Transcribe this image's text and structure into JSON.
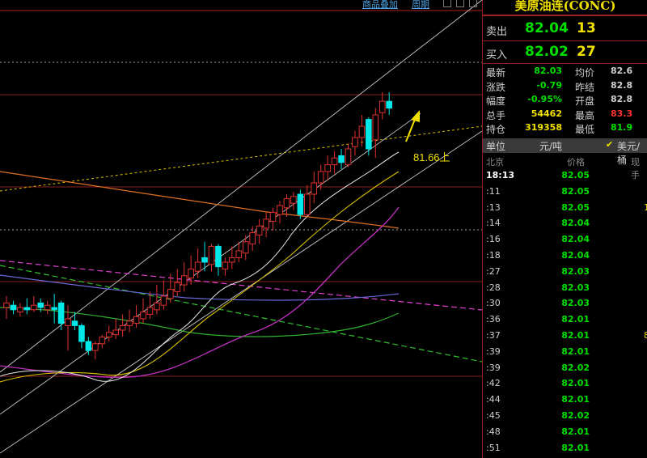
{
  "toolbar": {
    "link1": "商品叠加",
    "link2": "周期"
  },
  "chart_data": {
    "type": "candlestick",
    "annotation": "81.66上",
    "candles": [
      {
        "o": 0.5,
        "c": 0.52,
        "h": 0.55,
        "l": 0.45
      },
      {
        "o": 0.51,
        "c": 0.49,
        "h": 0.53,
        "l": 0.47
      },
      {
        "o": 0.48,
        "c": 0.5,
        "h": 0.52,
        "l": 0.46
      },
      {
        "o": 0.5,
        "c": 0.49,
        "h": 0.54,
        "l": 0.47
      },
      {
        "o": 0.49,
        "c": 0.51,
        "h": 0.55,
        "l": 0.48
      },
      {
        "o": 0.52,
        "c": 0.5,
        "h": 0.54,
        "l": 0.48
      },
      {
        "o": 0.49,
        "c": 0.51,
        "h": 0.53,
        "l": 0.47
      },
      {
        "o": 0.5,
        "c": 0.49,
        "h": 0.56,
        "l": 0.43
      },
      {
        "o": 0.52,
        "c": 0.43,
        "h": 0.53,
        "l": 0.4
      },
      {
        "o": 0.42,
        "c": 0.45,
        "h": 0.51,
        "l": 0.31
      },
      {
        "o": 0.44,
        "c": 0.42,
        "h": 0.48,
        "l": 0.4
      },
      {
        "o": 0.42,
        "c": 0.35,
        "h": 0.43,
        "l": 0.32
      },
      {
        "o": 0.35,
        "c": 0.31,
        "h": 0.37,
        "l": 0.29
      },
      {
        "o": 0.31,
        "c": 0.34,
        "h": 0.35,
        "l": 0.27
      },
      {
        "o": 0.34,
        "c": 0.37,
        "h": 0.38,
        "l": 0.32
      },
      {
        "o": 0.37,
        "c": 0.39,
        "h": 0.42,
        "l": 0.35
      },
      {
        "o": 0.38,
        "c": 0.4,
        "h": 0.45,
        "l": 0.36
      },
      {
        "o": 0.4,
        "c": 0.42,
        "h": 0.47,
        "l": 0.37
      },
      {
        "o": 0.42,
        "c": 0.44,
        "h": 0.49,
        "l": 0.39
      },
      {
        "o": 0.43,
        "c": 0.46,
        "h": 0.51,
        "l": 0.41
      },
      {
        "o": 0.45,
        "c": 0.48,
        "h": 0.54,
        "l": 0.43
      },
      {
        "o": 0.47,
        "c": 0.5,
        "h": 0.57,
        "l": 0.45
      },
      {
        "o": 0.49,
        "c": 0.52,
        "h": 0.6,
        "l": 0.47
      },
      {
        "o": 0.51,
        "c": 0.55,
        "h": 0.62,
        "l": 0.49
      },
      {
        "o": 0.54,
        "c": 0.58,
        "h": 0.65,
        "l": 0.52
      },
      {
        "o": 0.57,
        "c": 0.61,
        "h": 0.67,
        "l": 0.55
      },
      {
        "o": 0.6,
        "c": 0.64,
        "h": 0.7,
        "l": 0.57
      },
      {
        "o": 0.63,
        "c": 0.67,
        "h": 0.73,
        "l": 0.6
      },
      {
        "o": 0.66,
        "c": 0.7,
        "h": 0.76,
        "l": 0.63
      },
      {
        "o": 0.72,
        "c": 0.7,
        "h": 0.79,
        "l": 0.66
      },
      {
        "o": 0.69,
        "c": 0.77,
        "h": 0.78,
        "l": 0.66
      },
      {
        "o": 0.77,
        "c": 0.68,
        "h": 0.78,
        "l": 0.64
      },
      {
        "o": 0.67,
        "c": 0.7,
        "h": 0.72,
        "l": 0.64
      },
      {
        "o": 0.7,
        "c": 0.72,
        "h": 0.77,
        "l": 0.67
      },
      {
        "o": 0.72,
        "c": 0.75,
        "h": 0.79,
        "l": 0.7
      },
      {
        "o": 0.74,
        "c": 0.79,
        "h": 0.82,
        "l": 0.71
      },
      {
        "o": 0.78,
        "c": 0.83,
        "h": 0.86,
        "l": 0.75
      },
      {
        "o": 0.82,
        "c": 0.86,
        "h": 0.89,
        "l": 0.78
      },
      {
        "o": 0.85,
        "c": 0.89,
        "h": 0.92,
        "l": 0.81
      },
      {
        "o": 0.88,
        "c": 0.92,
        "h": 0.94,
        "l": 0.84
      },
      {
        "o": 0.91,
        "c": 0.95,
        "h": 0.97,
        "l": 0.87
      },
      {
        "o": 0.94,
        "c": 0.98,
        "h": 1.0,
        "l": 0.9
      },
      {
        "o": 0.96,
        "c": 0.99,
        "h": 1.01,
        "l": 0.93
      },
      {
        "o": 1.0,
        "c": 0.91,
        "h": 1.02,
        "l": 0.89
      },
      {
        "o": 0.91,
        "c": 1.0,
        "h": 1.04,
        "l": 0.9
      },
      {
        "o": 1.0,
        "c": 1.05,
        "h": 1.1,
        "l": 0.96
      },
      {
        "o": 1.05,
        "c": 1.1,
        "h": 1.13,
        "l": 1.02
      },
      {
        "o": 1.1,
        "c": 1.13,
        "h": 1.17,
        "l": 1.06
      },
      {
        "o": 1.13,
        "c": 1.16,
        "h": 1.19,
        "l": 1.09
      },
      {
        "o": 1.17,
        "c": 1.14,
        "h": 1.2,
        "l": 1.11
      },
      {
        "o": 1.13,
        "c": 1.2,
        "h": 1.22,
        "l": 1.12
      },
      {
        "o": 1.21,
        "c": 1.25,
        "h": 1.28,
        "l": 1.17
      },
      {
        "o": 1.25,
        "c": 1.3,
        "h": 1.35,
        "l": 1.21
      },
      {
        "o": 1.33,
        "c": 1.2,
        "h": 1.34,
        "l": 1.17
      },
      {
        "o": 1.24,
        "c": 1.35,
        "h": 1.38,
        "l": 1.16
      },
      {
        "o": 1.36,
        "c": 1.41,
        "h": 1.45,
        "l": 1.33
      },
      {
        "o": 1.41,
        "c": 1.38,
        "h": 1.45,
        "l": 1.35
      }
    ]
  },
  "panel": {
    "title": "美原油连(CONC)",
    "sell": {
      "label": "卖出",
      "price": "82.04",
      "vol": "13"
    },
    "buy": {
      "label": "买入",
      "price": "82.02",
      "vol": "27"
    },
    "stats": [
      {
        "l1": "最新",
        "v1": "82.03",
        "c1": "#00e000",
        "l2": "均价",
        "v2": "82.6",
        "c2": "#d0d0d0"
      },
      {
        "l1": "涨跌",
        "v1": "-0.79",
        "c1": "#00e000",
        "l2": "昨结",
        "v2": "82.8",
        "c2": "#d0d0d0"
      },
      {
        "l1": "幅度",
        "v1": "-0.95%",
        "c1": "#00e000",
        "l2": "开盘",
        "v2": "82.8",
        "c2": "#d0d0d0"
      },
      {
        "l1": "总手",
        "v1": "54462",
        "c1": "#f0e000",
        "l2": "最高",
        "v2": "83.3",
        "c2": "#ff3030"
      },
      {
        "l1": "持仓",
        "v1": "319358",
        "c1": "#f0e000",
        "l2": "最低",
        "v2": "81.9",
        "c2": "#00e000"
      }
    ],
    "unit": {
      "label": "单位",
      "value": "元/吨",
      "check": "✔",
      "alt": "美元/桶"
    },
    "ticks_header": {
      "place": "北京",
      "price": "价格",
      "vol": "现手"
    },
    "ticks": [
      {
        "t": "18:13",
        "p": "82.05",
        "v": ""
      },
      {
        "t": ":11",
        "p": "82.05",
        "v": ""
      },
      {
        "t": ":13",
        "p": "82.05",
        "v": "1"
      },
      {
        "t": ":14",
        "p": "82.04",
        "v": ""
      },
      {
        "t": ":16",
        "p": "82.04",
        "v": ""
      },
      {
        "t": ":18",
        "p": "82.04",
        "v": ""
      },
      {
        "t": ":27",
        "p": "82.03",
        "v": ""
      },
      {
        "t": ":28",
        "p": "82.03",
        "v": ""
      },
      {
        "t": ":30",
        "p": "82.03",
        "v": ""
      },
      {
        "t": ":36",
        "p": "82.01",
        "v": ""
      },
      {
        "t": ":37",
        "p": "82.01",
        "v": "8"
      },
      {
        "t": ":39",
        "p": "82.01",
        "v": ""
      },
      {
        "t": ":39",
        "p": "82.02",
        "v": ""
      },
      {
        "t": ":42",
        "p": "82.01",
        "v": ""
      },
      {
        "t": ":44",
        "p": "82.01",
        "v": ""
      },
      {
        "t": ":45",
        "p": "82.02",
        "v": ""
      },
      {
        "t": ":48",
        "p": "82.01",
        "v": ""
      },
      {
        "t": ":51",
        "p": "82.01",
        "v": ""
      }
    ]
  }
}
